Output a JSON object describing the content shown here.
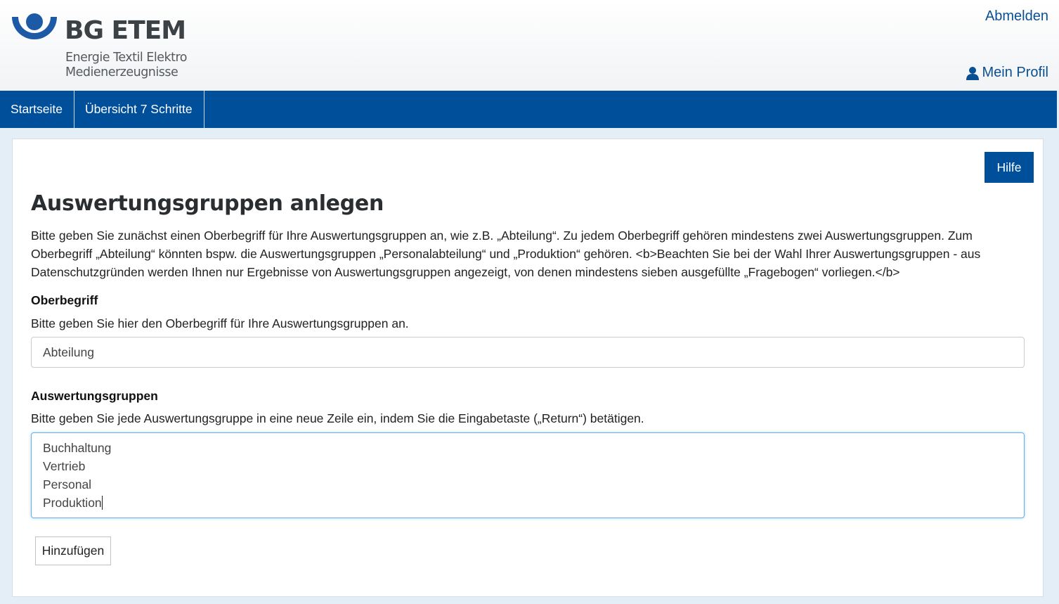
{
  "header": {
    "logo_name": "BG ETEM",
    "logo_subtitle": "Energie Textil Elektro\nMedienerzeugnisse",
    "logout_label": "Abmelden",
    "profile_label": "Mein Profil",
    "profile_icon": "user-icon"
  },
  "nav": {
    "items": [
      {
        "label": "Startseite"
      },
      {
        "label": "Übersicht 7 Schritte"
      }
    ]
  },
  "main": {
    "help_label": "Hilfe",
    "title": "Auswertungsgruppen anlegen",
    "intro": "Bitte geben Sie zunächst einen Oberbegriff für Ihre Auswertungsgruppen an, wie z.B. „Abteilung“. Zu jedem Oberbegriff gehören mindestens zwei Auswertungsgruppen. Zum Oberbegriff „Abteilung“ könnten bspw. die Auswertungsgruppen „Personalabteilung“ und „Produktion“ gehören. <b>Beachten Sie bei der Wahl Ihrer Auswertungsgruppen - aus Datenschutzgründen werden Ihnen nur Ergebnisse von Auswertungsgruppen angezeigt, von denen mindestens sieben ausgefüllte „Fragebogen“ vorliegen.</b>",
    "oberbegriff": {
      "label": "Oberbegriff",
      "hint": "Bitte geben Sie hier den Oberbegriff für Ihre Auswertungsgruppen an.",
      "value": "Abteilung"
    },
    "gruppen": {
      "label": "Auswertungsgruppen",
      "hint": "Bitte geben Sie jede Auswertungsgruppe in eine neue Zeile ein, indem Sie die Eingabetaste („Return“) betätigen.",
      "lines": [
        "Buchhaltung",
        "Vertrieb",
        "Personal",
        "Produktion"
      ]
    },
    "add_label": "Hinzufügen"
  },
  "colors": {
    "brand_blue": "#004f9a",
    "link_blue": "#0b4f93",
    "background": "#e3eef6"
  }
}
